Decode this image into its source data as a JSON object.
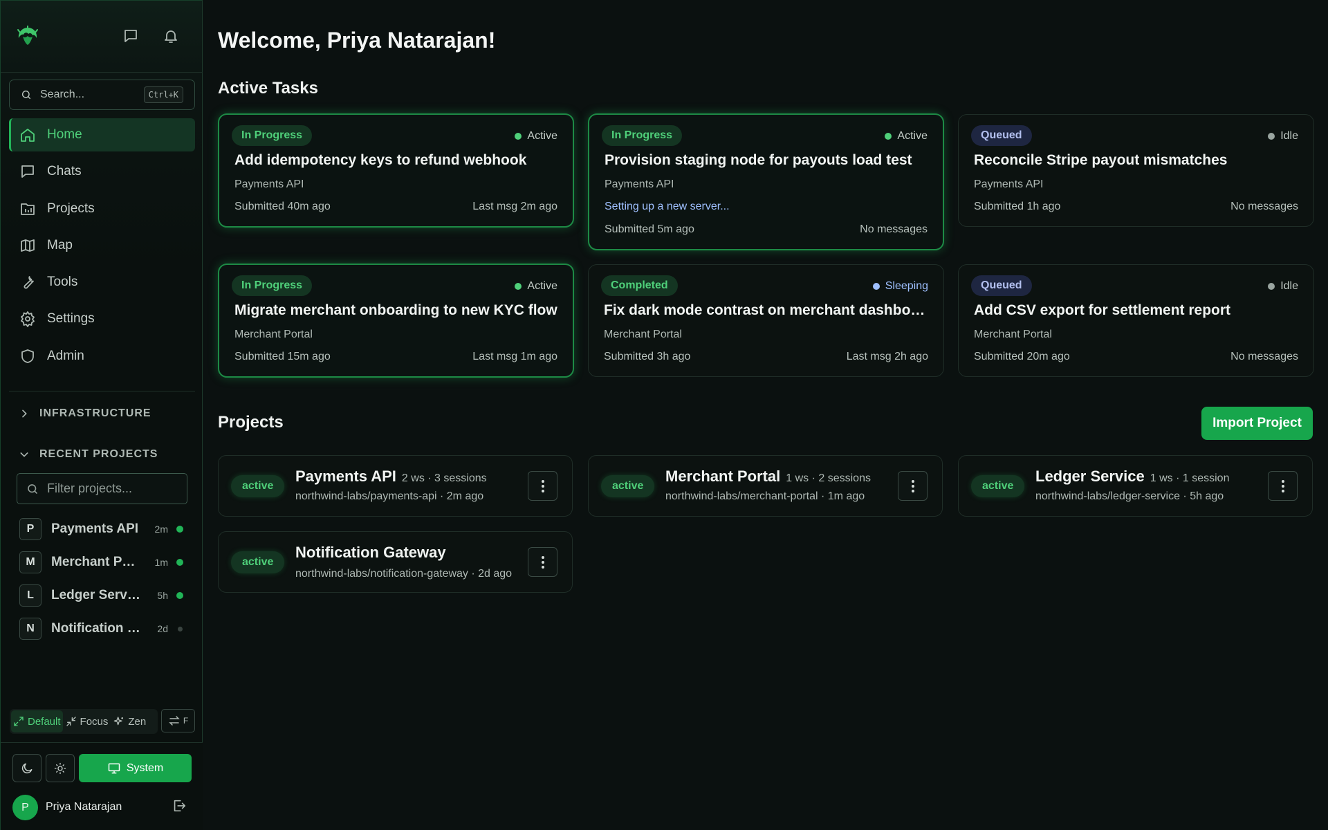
{
  "header": {
    "chat_icon": "message-square-icon",
    "bell_icon": "bell-icon"
  },
  "search": {
    "placeholder": "Search...",
    "shortcut": "Ctrl+K"
  },
  "nav": [
    {
      "label": "Home",
      "icon": "home-icon",
      "active": true
    },
    {
      "label": "Chats",
      "icon": "message-square-icon"
    },
    {
      "label": "Projects",
      "icon": "folder-chart-icon"
    },
    {
      "label": "Map",
      "icon": "map-icon"
    },
    {
      "label": "Tools",
      "icon": "wrench-icon"
    },
    {
      "label": "Settings",
      "icon": "gear-icon"
    },
    {
      "label": "Admin",
      "icon": "shield-icon"
    }
  ],
  "sections": {
    "infrastructure": "INFRASTRUCTURE",
    "recent_projects": "RECENT PROJECTS"
  },
  "filter": {
    "placeholder": "Filter projects..."
  },
  "recent_projects": [
    {
      "initial": "P",
      "name": "Payments API",
      "time": "2m",
      "online": true
    },
    {
      "initial": "M",
      "name": "Merchant Portal",
      "time": "1m",
      "online": true
    },
    {
      "initial": "L",
      "name": "Ledger Service",
      "time": "5h",
      "online": true
    },
    {
      "initial": "N",
      "name": "Notification Gateway",
      "time": "2d",
      "online": false
    }
  ],
  "modes": {
    "default": "Default",
    "focus": "Focus",
    "zen": "Zen",
    "toggle": "F"
  },
  "theme": {
    "system_label": "System"
  },
  "user": {
    "initial": "P",
    "name": "Priya Natarajan"
  },
  "main": {
    "welcome": "Welcome, Priya Natarajan!",
    "active_tasks_title": "Active Tasks",
    "projects_title": "Projects",
    "import_label": "Import Project"
  },
  "tasks": [
    {
      "badge": "In Progress",
      "status": "Active",
      "title": "Add idempotency keys to refund webhook",
      "project": "Payments API",
      "note": "",
      "submitted": "Submitted 40m ago",
      "last": "Last msg 2m ago"
    },
    {
      "badge": "In Progress",
      "status": "Active",
      "title": "Provision staging node for payouts load test",
      "project": "Payments API",
      "note": "Setting up a new server...",
      "submitted": "Submitted 5m ago",
      "last": "No messages"
    },
    {
      "badge": "Queued",
      "status": "Idle",
      "title": "Reconcile Stripe payout mismatches",
      "project": "Payments API",
      "note": "",
      "submitted": "Submitted 1h ago",
      "last": "No messages"
    },
    {
      "badge": "In Progress",
      "status": "Active",
      "title": "Migrate merchant onboarding to new KYC flow",
      "project": "Merchant Portal",
      "note": "",
      "submitted": "Submitted 15m ago",
      "last": "Last msg 1m ago"
    },
    {
      "badge": "Completed",
      "status": "Sleeping",
      "title": "Fix dark mode contrast on merchant dashboard",
      "project": "Merchant Portal",
      "note": "",
      "submitted": "Submitted 3h ago",
      "last": "Last msg 2h ago"
    },
    {
      "badge": "Queued",
      "status": "Idle",
      "title": "Add CSV export for settlement report",
      "project": "Merchant Portal",
      "note": "",
      "submitted": "Submitted 20m ago",
      "last": "No messages"
    }
  ],
  "projects": [
    {
      "status": "active",
      "name": "Payments API",
      "meta": "2 ws · 3 sessions",
      "repo": "northwind-labs/payments-api · 2m ago"
    },
    {
      "status": "active",
      "name": "Merchant Portal",
      "meta": "1 ws · 2 sessions",
      "repo": "northwind-labs/merchant-portal · 1m ago"
    },
    {
      "status": "active",
      "name": "Ledger Service",
      "meta": "1 ws · 1 session",
      "repo": "northwind-labs/ledger-service · 5h ago"
    },
    {
      "status": "active",
      "name": "Notification Gateway",
      "meta": "",
      "repo": "northwind-labs/notification-gateway · 2d ago"
    }
  ],
  "colors": {
    "accent": "#17a64c",
    "accent_text": "#4fd07a",
    "background": "#0b1110",
    "queued": "#b3c0ef",
    "sleeping": "#9fc0ff"
  }
}
